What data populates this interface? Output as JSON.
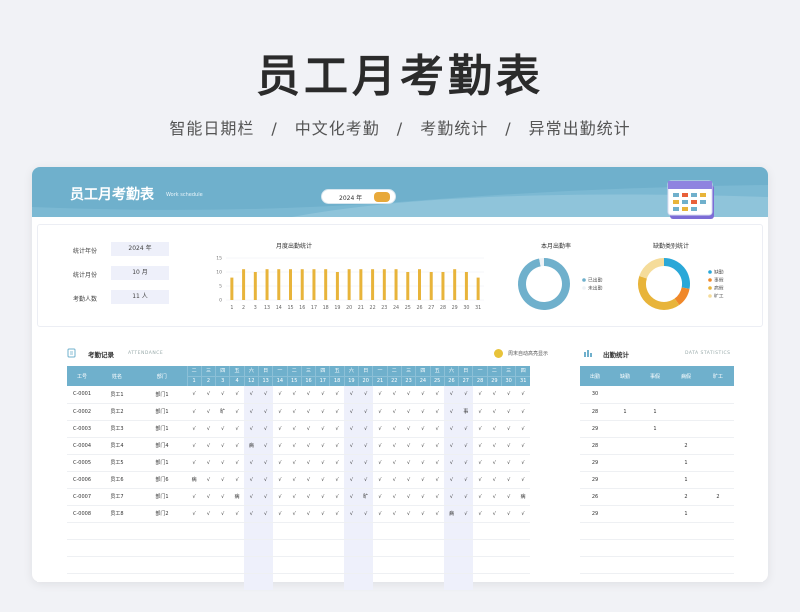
{
  "page": {
    "title": "员工月考勤表",
    "subtitle": "智能日期栏　/　中文化考勤　/　考勤统计　/　异常出勤统计"
  },
  "header": {
    "title": "员工月考勤表",
    "subtitle": "Work schedule",
    "year_label": "2024 年"
  },
  "info": {
    "year_key": "统计年份",
    "year_val": "2024 年",
    "month_key": "统计月份",
    "month_val": "10 月",
    "count_key": "考勤人数",
    "count_val": "11 人"
  },
  "colors": {
    "accent": "#6fb0cc",
    "bar": "#e8b43a",
    "weekend": "#eef0fb"
  },
  "chart_data": [
    {
      "type": "bar",
      "title": "月度出勤统计",
      "categories": [
        "1",
        "2",
        "3",
        "13",
        "14",
        "15",
        "16",
        "17",
        "18",
        "19",
        "20",
        "21",
        "22",
        "23",
        "24",
        "25",
        "26",
        "27",
        "28",
        "29",
        "30",
        "31"
      ],
      "values": [
        8,
        11,
        10,
        11,
        11,
        11,
        11,
        11,
        11,
        10,
        11,
        11,
        11,
        11,
        11,
        10,
        11,
        10,
        10,
        11,
        10,
        8
      ],
      "ylim": [
        0,
        15
      ],
      "yticks": [
        0,
        5,
        10,
        15
      ]
    },
    {
      "type": "pie",
      "title": "本月出勤率",
      "categories": [
        "已出勤",
        "未出勤"
      ],
      "values": [
        97,
        3
      ],
      "colors": [
        "#6fb0cc",
        "#eef2f6"
      ]
    },
    {
      "type": "pie",
      "title": "缺勤类别统计",
      "categories": [
        "缺勤",
        "事假",
        "病假",
        "旷工"
      ],
      "values": [
        28,
        12,
        40,
        20
      ],
      "colors": [
        "#2aa8d8",
        "#f0882a",
        "#e8b43a",
        "#f5dc9a"
      ]
    }
  ],
  "attendance": {
    "title": "考勤记录",
    "title_en": "ATTENDANCE",
    "note": "周末自动高亮显示",
    "headers": {
      "id": "工号",
      "name": "姓名",
      "dept": "部门"
    },
    "weekday_row": [
      "二",
      "三",
      "四",
      "五",
      "六",
      "日",
      "一",
      "二",
      "三",
      "四",
      "五",
      "六",
      "日",
      "一",
      "二",
      "三",
      "四",
      "五",
      "六",
      "日",
      "一",
      "二",
      "三",
      "四"
    ],
    "day_row": [
      "1",
      "2",
      "3",
      "4",
      "12",
      "13",
      "14",
      "15",
      "16",
      "17",
      "18",
      "19",
      "20",
      "21",
      "22",
      "23",
      "24",
      "25",
      "26",
      "27",
      "28",
      "29",
      "30",
      "31"
    ],
    "rows": [
      {
        "id": "C-0001",
        "name": "员工1",
        "dept": "部门1",
        "days": [
          "√",
          "√",
          "√",
          "√",
          "√",
          "√",
          "√",
          "√",
          "√",
          "√",
          "√",
          "√",
          "√",
          "√",
          "√",
          "√",
          "√",
          "√",
          "√",
          "√",
          "√",
          "√",
          "√",
          "√"
        ]
      },
      {
        "id": "C-0002",
        "name": "员工2",
        "dept": "部门1",
        "days": [
          "√",
          "√",
          "旷",
          "√",
          "√",
          "√",
          "√",
          "√",
          "√",
          "√",
          "√",
          "√",
          "√",
          "√",
          "√",
          "√",
          "√",
          "√",
          "√",
          "事",
          "√",
          "√",
          "√",
          "√"
        ]
      },
      {
        "id": "C-0003",
        "name": "员工3",
        "dept": "部门1",
        "days": [
          "√",
          "√",
          "√",
          "√",
          "√",
          "√",
          "√",
          "√",
          "√",
          "√",
          "√",
          "√",
          "√",
          "√",
          "√",
          "√",
          "√",
          "√",
          "√",
          "√",
          "√",
          "√",
          "√",
          "√"
        ]
      },
      {
        "id": "C-0004",
        "name": "员工4",
        "dept": "部门4",
        "days": [
          "√",
          "√",
          "√",
          "√",
          "病",
          "√",
          "√",
          "√",
          "√",
          "√",
          "√",
          "√",
          "√",
          "√",
          "√",
          "√",
          "√",
          "√",
          "√",
          "√",
          "√",
          "√",
          "√",
          "√"
        ]
      },
      {
        "id": "C-0005",
        "name": "员工5",
        "dept": "部门1",
        "days": [
          "√",
          "√",
          "√",
          "√",
          "√",
          "√",
          "√",
          "√",
          "√",
          "√",
          "√",
          "√",
          "√",
          "√",
          "√",
          "√",
          "√",
          "√",
          "√",
          "√",
          "√",
          "√",
          "√",
          "√"
        ]
      },
      {
        "id": "C-0006",
        "name": "员工6",
        "dept": "部门6",
        "days": [
          "病",
          "√",
          "√",
          "√",
          "√",
          "√",
          "√",
          "√",
          "√",
          "√",
          "√",
          "√",
          "√",
          "√",
          "√",
          "√",
          "√",
          "√",
          "√",
          "√",
          "√",
          "√",
          "√",
          "√"
        ]
      },
      {
        "id": "C-0007",
        "name": "员工7",
        "dept": "部门1",
        "days": [
          "√",
          "√",
          "√",
          "病",
          "√",
          "√",
          "√",
          "√",
          "√",
          "√",
          "√",
          "√",
          "旷",
          "√",
          "√",
          "√",
          "√",
          "√",
          "√",
          "√",
          "√",
          "√",
          "√",
          "病"
        ]
      },
      {
        "id": "C-0008",
        "name": "员工8",
        "dept": "部门2",
        "days": [
          "√",
          "√",
          "√",
          "√",
          "√",
          "√",
          "√",
          "√",
          "√",
          "√",
          "√",
          "√",
          "√",
          "√",
          "√",
          "√",
          "√",
          "√",
          "病",
          "√",
          "√",
          "√",
          "√",
          "√"
        ]
      }
    ]
  },
  "statistics": {
    "title": "出勤统计",
    "title_en": "DATA STATISTICS",
    "headers": [
      "出勤",
      "缺勤",
      "事假",
      "病假",
      "旷工"
    ],
    "rows": [
      [
        "30",
        "",
        "",
        "",
        ""
      ],
      [
        "28",
        "1",
        "1",
        "",
        ""
      ],
      [
        "29",
        "",
        "1",
        "",
        ""
      ],
      [
        "28",
        "",
        "",
        "2",
        ""
      ],
      [
        "29",
        "",
        "",
        "1",
        ""
      ],
      [
        "29",
        "",
        "",
        "1",
        ""
      ],
      [
        "26",
        "",
        "",
        "2",
        "2"
      ],
      [
        "29",
        "",
        "",
        "1",
        ""
      ]
    ]
  }
}
